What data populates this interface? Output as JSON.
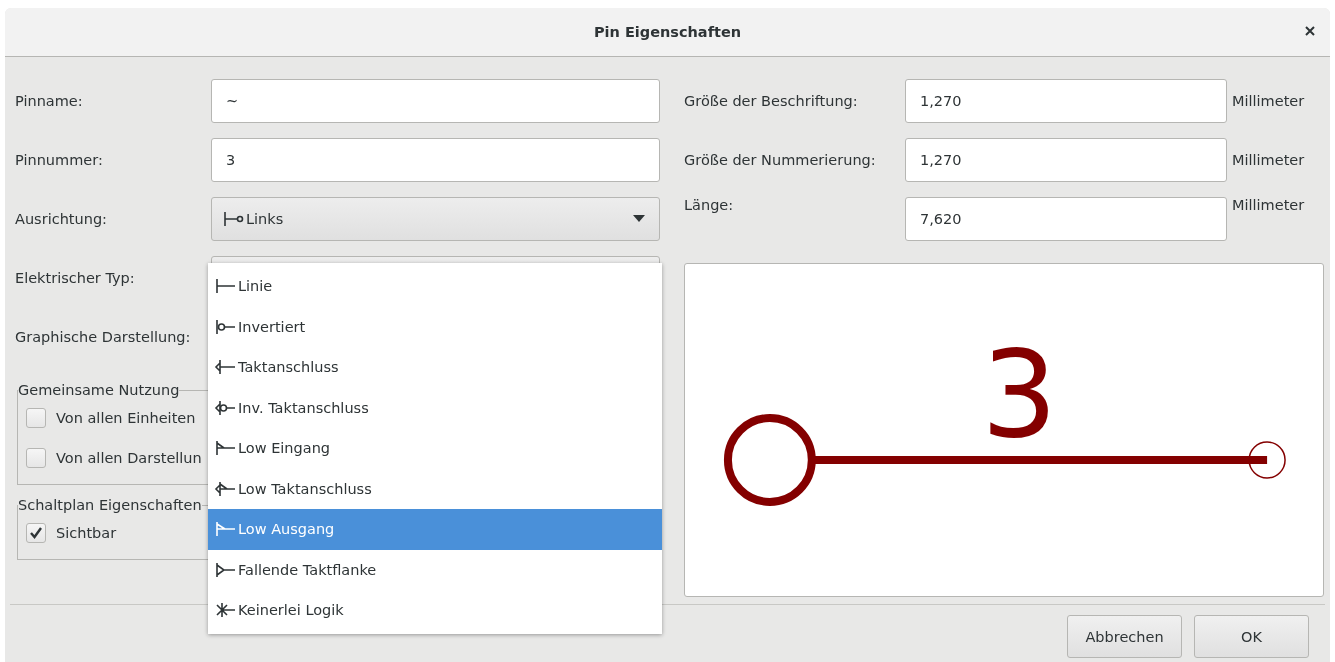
{
  "window": {
    "title": "Pin Eigenschaften"
  },
  "left_fields": [
    {
      "label": "Pinname:",
      "kind": "text",
      "value": "~"
    },
    {
      "label": "Pinnummer:",
      "kind": "text",
      "value": "3"
    },
    {
      "label": "Ausrichtung:",
      "kind": "combo",
      "value": "Links"
    },
    {
      "label": "Elektrischer Typ:",
      "kind": "covered"
    },
    {
      "label": "Graphische Darstellung:",
      "kind": "none"
    }
  ],
  "right_fields": [
    {
      "label": "Größe der Beschriftung:",
      "value": "1,270",
      "unit": "Millimeter"
    },
    {
      "label": "Größe der Nummerierung:",
      "value": "1,270",
      "unit": "Millimeter"
    },
    {
      "label": "Länge:",
      "value": "7,620",
      "unit": "Millimeter"
    }
  ],
  "groups": [
    {
      "title": "Gemeinsame Nutzung",
      "options": [
        {
          "label": "Von allen Einheiten",
          "checked": false
        },
        {
          "label": "Von allen Darstellun",
          "checked": false
        }
      ]
    },
    {
      "title": "Schaltplan Eigenschaften",
      "options": [
        {
          "label": "Sichtbar",
          "checked": true
        }
      ]
    }
  ],
  "dropdown": [
    {
      "label": "Linie",
      "kind": "line",
      "selected": false
    },
    {
      "label": "Invertiert",
      "kind": "inverted",
      "selected": false
    },
    {
      "label": "Taktanschluss",
      "kind": "clock",
      "selected": false
    },
    {
      "label": "Inv. Taktanschluss",
      "kind": "inv-clock",
      "selected": false
    },
    {
      "label": "Low Eingang",
      "kind": "low-in",
      "selected": false
    },
    {
      "label": "Low Taktanschluss",
      "kind": "low-clock",
      "selected": false
    },
    {
      "label": "Low Ausgang",
      "kind": "low-out",
      "selected": true
    },
    {
      "label": "Fallende Taktflanke",
      "kind": "falling",
      "selected": false
    },
    {
      "label": "Keinerlei Logik",
      "kind": "nologic",
      "selected": false
    }
  ],
  "preview": {
    "pin_number": "3"
  },
  "buttons": [
    "Abbrechen",
    "OK"
  ]
}
